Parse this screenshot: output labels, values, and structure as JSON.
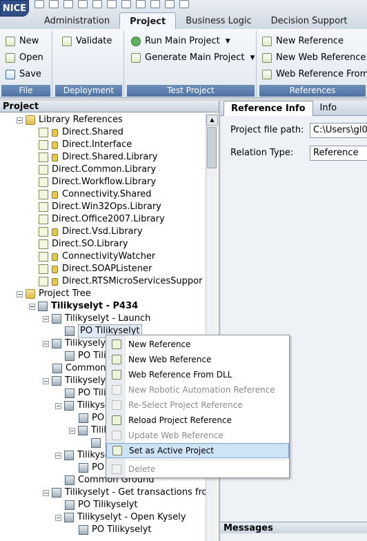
{
  "app": {
    "logo": "NICE"
  },
  "menu_tabs": [
    "Administration",
    "Project",
    "Business Logic",
    "Decision Support"
  ],
  "ribbon": {
    "file": {
      "new": "New",
      "open": "Open",
      "save": "Save",
      "footer": "File"
    },
    "deployment": {
      "validate": "Validate",
      "footer": "Deployment"
    },
    "test_project": {
      "run": "Run Main Project",
      "generate": "Generate Main Project",
      "footer": "Test Project"
    },
    "references": {
      "new_ref": "New Reference",
      "new_web": "New Web Reference",
      "web_from": "Web Reference From",
      "footer": "References"
    }
  },
  "project_pane": {
    "title": "Project",
    "tree": [
      "Library References",
      "Direct.Shared",
      "Direct.Interface",
      "Direct.Shared.Library",
      "Direct.Common.Library",
      "Direct.Workflow.Library",
      "Connectivity.Shared",
      "Direct.Win32Ops.Library",
      "Direct.Office2007.Library",
      "Direct.Vsd.Library",
      "Direct.SO.Library",
      "ConnectivityWatcher",
      "Direct.SOAPListener",
      "Direct.RTSMicroServicesSuppor",
      "Project Tree",
      "Tilikyselyt - P434",
      "Tilikyselyt - Launch",
      "PO Tilikyselyt",
      "Tilikyselyt",
      "PO Tili",
      "Common",
      "Tilikyselyt",
      "PO Tili",
      "Tilikyse",
      "PO",
      "Tilik",
      "",
      "Tilikyse",
      "PO",
      "Common Ground",
      "Tilikyselyt - Get transactions fro",
      "PO Tilikyselyt",
      "Tilikyselyt - Open Kysely",
      "PO Tilikyselyt"
    ]
  },
  "right_pane": {
    "tabs": [
      "Reference Info",
      "Info"
    ],
    "project_file_path_label": "Project file path:",
    "project_file_path_value": "C:\\Users\\gl0",
    "relation_type_label": "Relation Type:",
    "relation_type_value": "Reference",
    "messages_label": "Messages"
  },
  "context_menu": {
    "items": [
      {
        "label": "New Reference",
        "enabled": true
      },
      {
        "label": "New Web Reference",
        "enabled": true
      },
      {
        "label": "Web Reference From DLL",
        "enabled": true
      },
      {
        "label": "New Robotic Automation Reference",
        "enabled": false
      },
      {
        "label": "Re-Select Project Reference",
        "enabled": false
      },
      {
        "label": "Reload Project Reference",
        "enabled": true
      },
      {
        "label": "Update Web Reference",
        "enabled": false
      },
      {
        "label": "Set as Active Project",
        "enabled": true,
        "highlighted": true
      },
      {
        "label": "Delete",
        "enabled": false
      }
    ]
  }
}
